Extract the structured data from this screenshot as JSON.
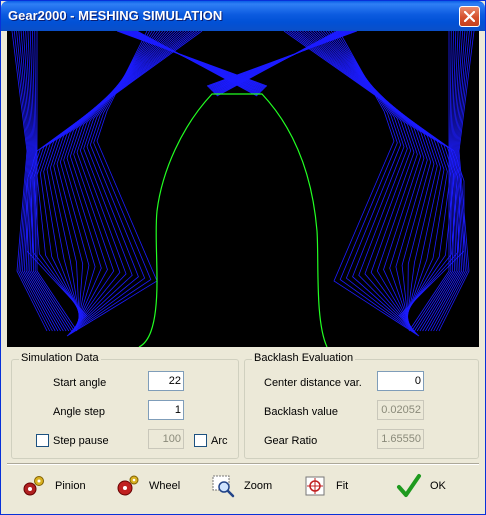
{
  "window": {
    "title": "Gear2000 - MESHING SIMULATION",
    "colors": {
      "titlebar": "#0151d6",
      "canvas_bg": "#000000",
      "tooth_lines": "#1c1cff",
      "profile": "#22ff22"
    }
  },
  "simulation_data": {
    "title": "Simulation Data",
    "start_angle_label": "Start angle",
    "start_angle_value": "22",
    "angle_step_label": "Angle step",
    "angle_step_value": "1",
    "step_pause_label": "Step pause",
    "step_pause_checked": false,
    "step_pause_value": "100",
    "arc_label": "Arc",
    "arc_checked": false
  },
  "backlash": {
    "title": "Backlash Evaluation",
    "center_distance_label": "Center distance var.",
    "center_distance_value": "0",
    "backlash_value_label": "Backlash value",
    "backlash_value": "0.02052",
    "gear_ratio_label": "Gear Ratio",
    "gear_ratio_value": "1.65550"
  },
  "toolbar": {
    "pinion": {
      "label": "Pinion",
      "icon": "pinion-gear-icon"
    },
    "wheel": {
      "label": "Wheel",
      "icon": "wheel-gear-icon"
    },
    "zoom": {
      "label": "Zoom",
      "icon": "magnifier-icon"
    },
    "fit": {
      "label": "Fit",
      "icon": "fit-target-icon"
    },
    "ok": {
      "label": "OK",
      "icon": "checkmark-icon"
    }
  }
}
